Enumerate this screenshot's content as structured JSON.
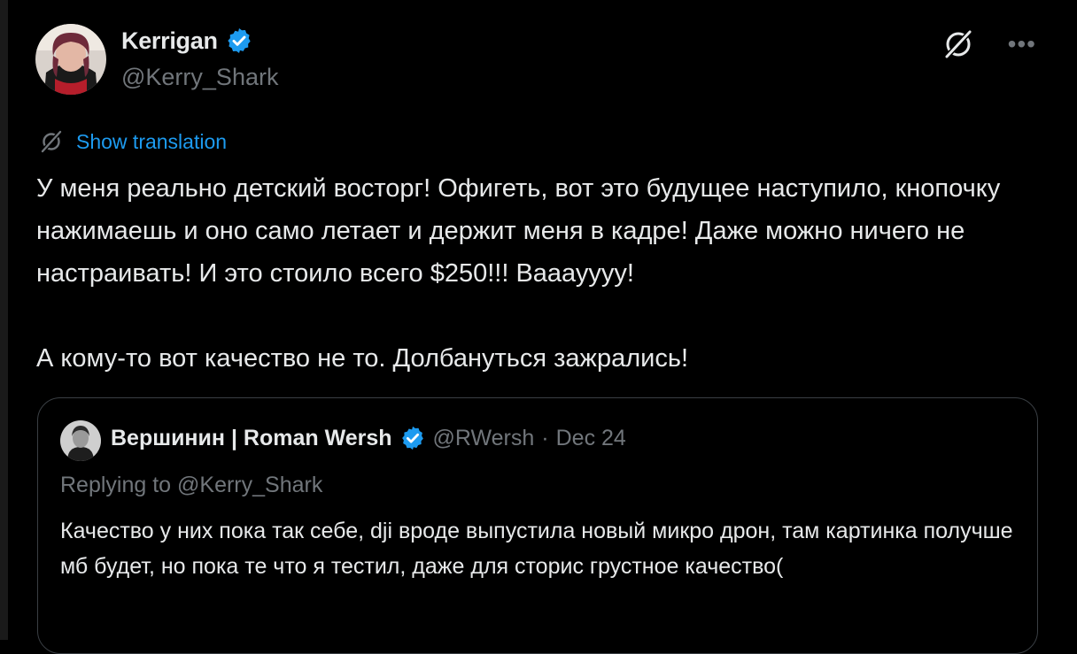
{
  "author": {
    "name": "Kerrigan",
    "handle": "@Kerry_Shark",
    "verified_color": "#1d9bf0"
  },
  "header_icons": [
    "grok-translate-icon",
    "more-icon"
  ],
  "translation": {
    "label": "Show translation",
    "icon": "translate-icon"
  },
  "tweet": {
    "text": "У меня реально детский восторг! Офигеть, вот это будущее наступило, кнопочку нажимаешь и оно само летает и держит меня в кадре! Даже можно ничего не настраивать! И это стоило всего $250!!! Вааауууу!\n\nА кому-то вот качество не то. Долбануться зажрались!"
  },
  "quote": {
    "name": "Вершинин | Roman Wersh",
    "handle": "@RWersh",
    "separator": "·",
    "date": "Dec 24",
    "replying": "Replying to @Kerry_Shark",
    "text": "Качество у них пока так себе, dji вроде выпустила новый микро дрон, там картинка получше мб будет, но пока те что я тестил, даже для сторис грустное качество("
  },
  "colors": {
    "background": "#000000",
    "text": "#e7e9ea",
    "muted": "#71767b",
    "accent": "#1d9bf0",
    "border": "#3a3f44"
  }
}
